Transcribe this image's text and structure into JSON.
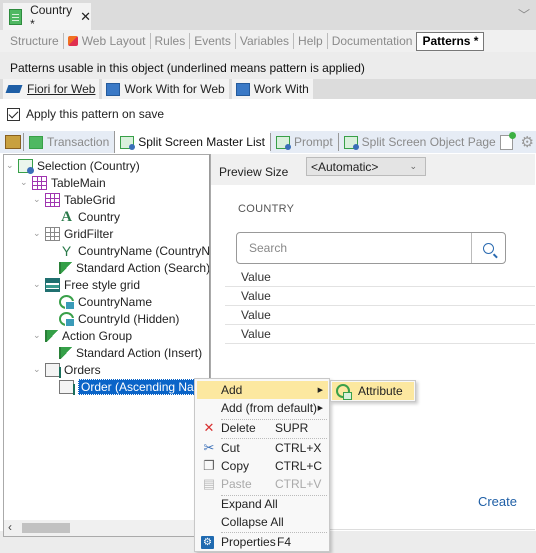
{
  "doc_tab": {
    "title": "Country *",
    "close": "✕"
  },
  "tabbar_chevron": "﹀",
  "editor_tabs": [
    {
      "label": "Structure"
    },
    {
      "label": "Web Layout"
    },
    {
      "label": "Rules"
    },
    {
      "label": "Events"
    },
    {
      "label": "Variables"
    },
    {
      "label": "Help"
    },
    {
      "label": "Documentation"
    },
    {
      "label": "Patterns *",
      "active": true
    }
  ],
  "patterns_description": "Patterns usable in this object (underlined means pattern is applied)",
  "pattern_tabs": [
    {
      "label": "Fiori for Web",
      "applied": true,
      "active": true
    },
    {
      "label": "Work With for Web"
    },
    {
      "label": "Work With"
    }
  ],
  "apply_on_save": {
    "label": "Apply this pattern on save",
    "checked": true
  },
  "instance_tabs": [
    {
      "label": "Transaction"
    },
    {
      "label": "Split Screen Master List",
      "active": true
    },
    {
      "label": "Prompt"
    },
    {
      "label": "Split Screen Object Page"
    }
  ],
  "tree": [
    {
      "label": "Selection (Country)",
      "icon": "selection-icon",
      "level": 0,
      "expanded": true
    },
    {
      "label": "TableMain",
      "icon": "table-icon",
      "level": 1,
      "expanded": true
    },
    {
      "label": "TableGrid",
      "icon": "table-icon",
      "level": 2,
      "expanded": true
    },
    {
      "label": "Country",
      "icon": "text-block-icon",
      "level": 3
    },
    {
      "label": "GridFilter",
      "icon": "grid-icon",
      "level": 2,
      "expanded": true
    },
    {
      "label": "CountryName (CountryN",
      "icon": "filter-icon",
      "level": 3
    },
    {
      "label": "Standard Action (Search)",
      "icon": "action-flag-icon",
      "level": 3
    },
    {
      "label": "Free style grid",
      "icon": "free-style-grid-icon",
      "level": 2,
      "expanded": true
    },
    {
      "label": "CountryName",
      "icon": "attribute-icon",
      "level": 3
    },
    {
      "label": "CountryId (Hidden)",
      "icon": "attribute-icon",
      "level": 3
    },
    {
      "label": "Action Group",
      "icon": "action-flag-icon",
      "level": 2,
      "expanded": true
    },
    {
      "label": "Standard Action (Insert)",
      "icon": "action-flag-icon",
      "level": 3
    },
    {
      "label": "Orders",
      "icon": "orders-icon",
      "level": 2,
      "expanded": true
    },
    {
      "label": "Order (Ascending Name)",
      "icon": "order-icon",
      "level": 3,
      "selected": true
    }
  ],
  "preview": {
    "size_label": "Preview Size",
    "size_value": "<Automatic>",
    "title": "COUNTRY",
    "search_placeholder": "Search",
    "values": [
      "Value",
      "Value",
      "Value",
      "Value"
    ],
    "create_label": "Create"
  },
  "context_menu": {
    "items": [
      {
        "label": "Add",
        "submenu": true,
        "highlighted": true
      },
      {
        "label": "Add (from default)",
        "submenu": true
      },
      {
        "label": "Delete",
        "shortcut": "SUPR",
        "icon": "delete-icon"
      },
      {
        "label": "Cut",
        "shortcut": "CTRL+X",
        "icon": "cut-icon"
      },
      {
        "label": "Copy",
        "shortcut": "CTRL+C",
        "icon": "copy-icon"
      },
      {
        "label": "Paste",
        "shortcut": "CTRL+V",
        "icon": "paste-icon",
        "disabled": true
      },
      {
        "label": "Expand All"
      },
      {
        "label": "Collapse All"
      },
      {
        "label": "Properties",
        "shortcut": "F4",
        "icon": "properties-icon"
      }
    ],
    "submenu": [
      {
        "label": "Attribute",
        "icon": "attribute-icon",
        "highlighted": true
      }
    ]
  }
}
